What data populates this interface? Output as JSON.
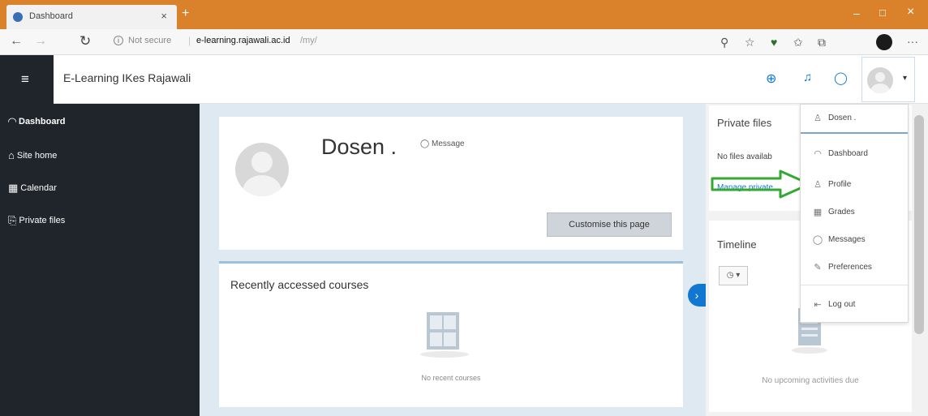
{
  "browser": {
    "tab_title": "Dashboard",
    "tab_close": "×",
    "new_tab": "+",
    "security_label": "Not secure",
    "url_host": "e-learning.rajawali.ac.id",
    "url_path": "/my/",
    "more_icon": "···"
  },
  "navbar": {
    "site_title": "E-Learning IKes Rajawali",
    "menu_icon": "≡",
    "caret": "▾"
  },
  "drawer": {
    "items": [
      {
        "icon": "◠",
        "label": "Dashboard",
        "active": true
      },
      {
        "icon": "⌂",
        "label": "Site home"
      },
      {
        "icon": "▦",
        "label": "Calendar"
      },
      {
        "icon": "⎘",
        "label": "Private files"
      }
    ]
  },
  "profile": {
    "name": "Dosen .",
    "message_label": "Message",
    "customise_button": "Customise this page"
  },
  "recent": {
    "title": "Recently accessed courses",
    "empty": "No recent courses"
  },
  "private_files": {
    "title": "Private files",
    "empty": "No files availab",
    "link": "Manage private"
  },
  "timeline": {
    "title": "Timeline",
    "filter_label": "◷ ▾",
    "empty": "No upcoming activities due"
  },
  "user_menu": {
    "items": [
      {
        "icon": "♙",
        "label": "Dosen ."
      },
      {
        "icon": "◠",
        "label": "Dashboard"
      },
      {
        "icon": "♙",
        "label": "Profile"
      },
      {
        "icon": "▦",
        "label": "Grades"
      },
      {
        "icon": "◯",
        "label": "Messages"
      },
      {
        "icon": "✎",
        "label": "Preferences"
      },
      {
        "icon": "⇤",
        "label": "Log out"
      }
    ]
  },
  "colors": {
    "accent": "#1177d1",
    "drawer_bg": "#1f252b",
    "tabbar": "#d9812b",
    "arrow": "#33a833"
  }
}
